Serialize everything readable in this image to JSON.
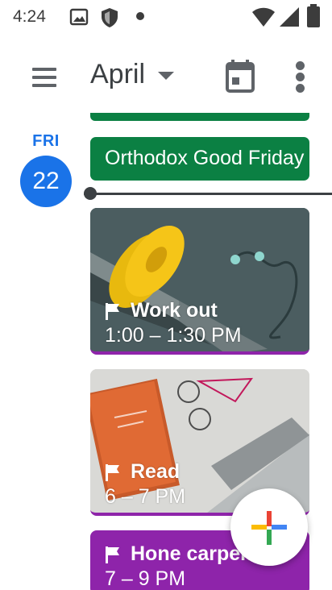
{
  "status_bar": {
    "time": "4:24",
    "icons": [
      "photos-icon",
      "shield-icon",
      "dot-icon",
      "wifi-icon",
      "signal-icon",
      "battery-icon"
    ]
  },
  "app_bar": {
    "month": "April",
    "menu_icon": "menu-icon",
    "today_icon": "calendar-today-icon",
    "more_icon": "more-vert-icon"
  },
  "day": {
    "weekday": "FRI",
    "date": "22"
  },
  "events": {
    "all_day": {
      "title": "Orthodox Good Friday"
    },
    "workout": {
      "title": "Work out",
      "time": "1:00 – 1:30 PM"
    },
    "read": {
      "title": "Read",
      "time": "6 – 7 PM"
    },
    "hone": {
      "title": "Hone carpentry",
      "time": "7 – 9 PM"
    }
  },
  "colors": {
    "accent": "#1a73e8",
    "event_green": "#0b8043",
    "event_purple": "#8e24aa"
  },
  "fab": {
    "icon": "plus-icon"
  }
}
